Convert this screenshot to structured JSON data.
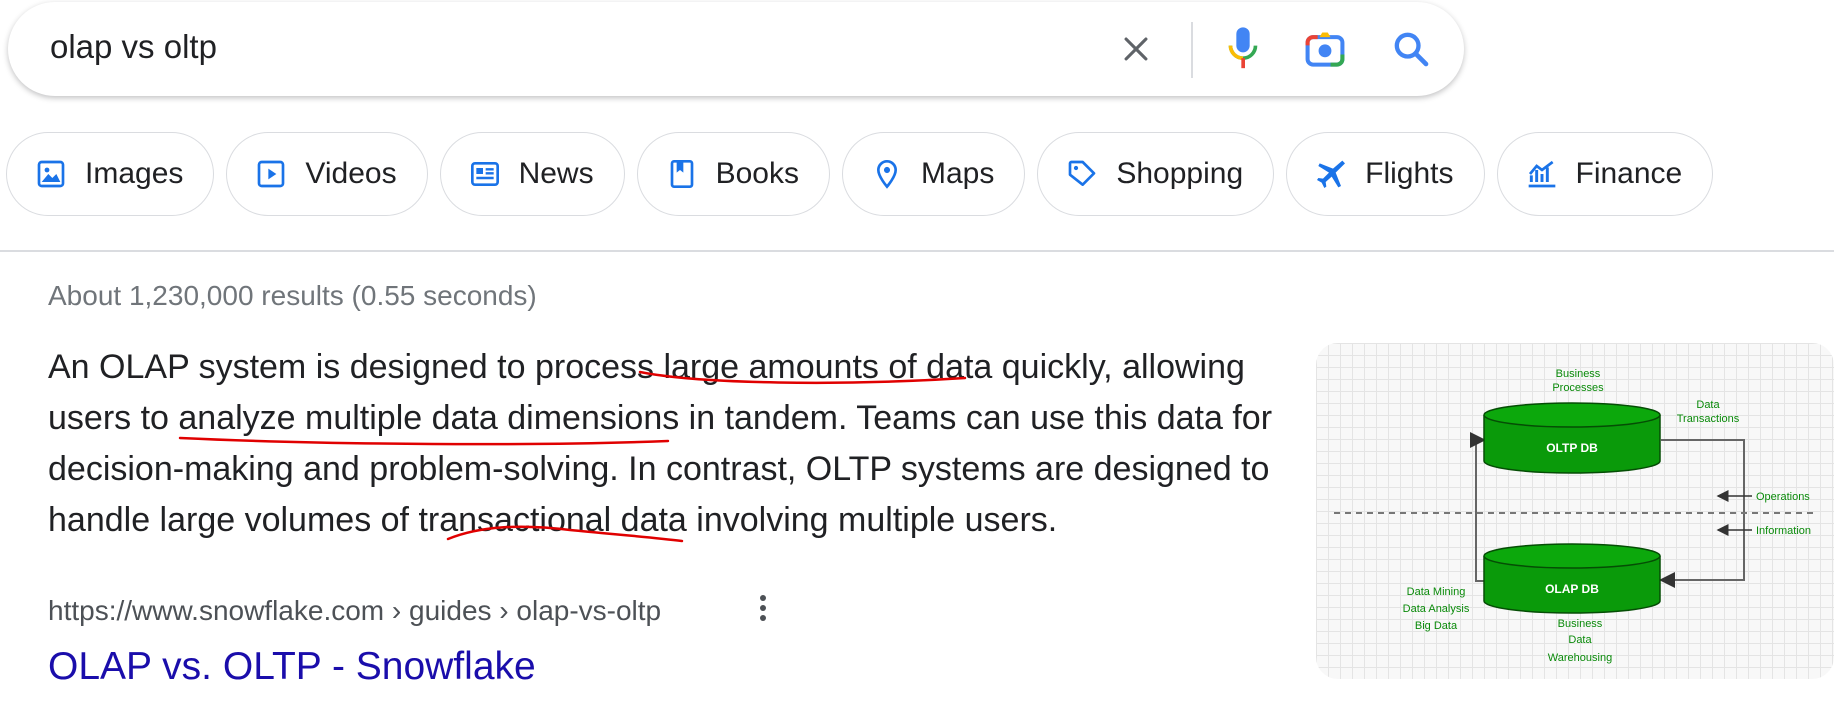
{
  "search": {
    "query": "olap vs oltp",
    "icons": [
      "clear-icon",
      "mic-icon",
      "camera-icon",
      "search-icon"
    ]
  },
  "chips": [
    {
      "label": "Images",
      "icon": "image-icon"
    },
    {
      "label": "Videos",
      "icon": "video-icon"
    },
    {
      "label": "News",
      "icon": "news-icon"
    },
    {
      "label": "Books",
      "icon": "book-icon"
    },
    {
      "label": "Maps",
      "icon": "map-pin-icon"
    },
    {
      "label": "Shopping",
      "icon": "tag-icon"
    },
    {
      "label": "Flights",
      "icon": "plane-icon"
    },
    {
      "label": "Finance",
      "icon": "chart-icon"
    }
  ],
  "result_stats": "About 1,230,000 results (0.55 seconds)",
  "snippet": {
    "lines": [
      "An OLAP system is designed to process large amounts of data quickly, allowing",
      "users to analyze multiple data dimensions in tandem. Teams can use this data for",
      "decision-making and problem-solving. In contrast, OLTP systems are designed to",
      "handle large volumes of transactional data involving multiple users."
    ],
    "annotation_color": "#e00000"
  },
  "result": {
    "cite": "https://www.snowflake.com › guides › olap-vs-oltp",
    "title": "OLAP vs. OLTP - Snowflake"
  },
  "thumbnail": {
    "oltp_db": "OLTP DB",
    "olap_db": "OLAP DB",
    "business_processes": [
      "Business",
      "Processes"
    ],
    "data_transactions": [
      "Data",
      "Transactions"
    ],
    "operations": "Operations",
    "information": "Information",
    "data_mining": [
      "Data Mining",
      "Data Analysis",
      "Big Data"
    ],
    "business_dw": [
      "Business",
      "Data",
      "Warehousing"
    ],
    "db_color": "#0a9a0a",
    "label_color": "#0a8a0a"
  },
  "colors": {
    "link": "#1a0dab",
    "google_blue": "#4285f4",
    "chip_icon": "#1a73e8"
  }
}
